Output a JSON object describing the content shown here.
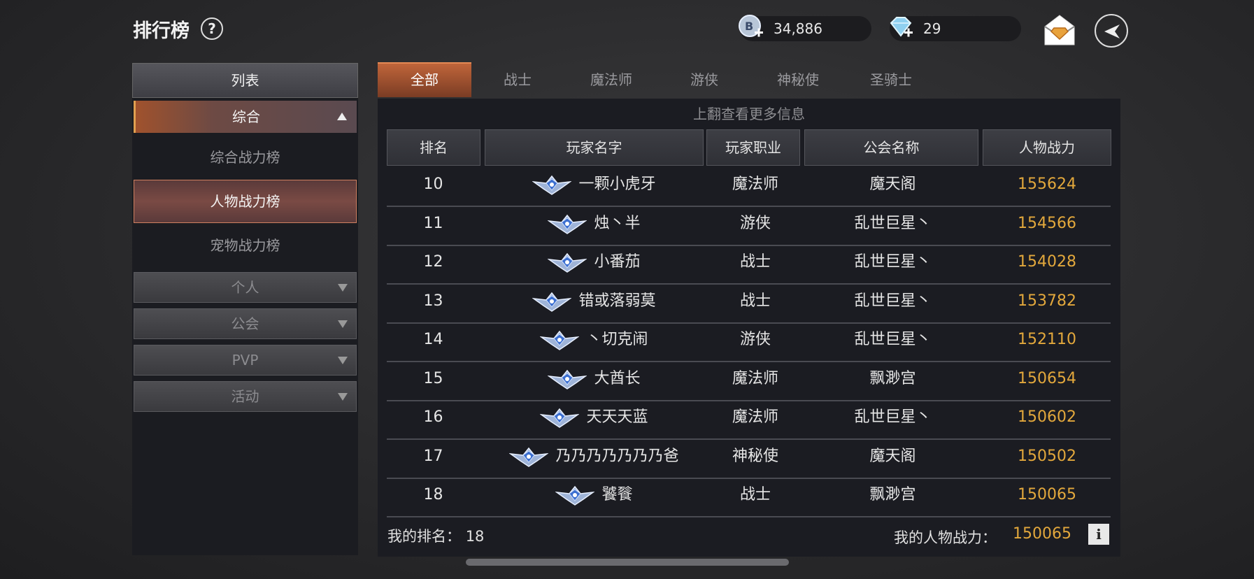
{
  "header": {
    "title": "排行榜",
    "help_label": "?",
    "gold_amount": "34,886",
    "diamond_amount": "29"
  },
  "sidebar": {
    "header": "列表",
    "active_category": "综合",
    "sub_items": [
      {
        "label": "综合战力榜",
        "active": false
      },
      {
        "label": "人物战力榜",
        "active": true
      },
      {
        "label": "宠物战力榜",
        "active": false
      }
    ],
    "categories": [
      "个人",
      "公会",
      "PVP",
      "活动"
    ]
  },
  "tabs": [
    {
      "label": "全部",
      "active": true
    },
    {
      "label": "战士",
      "active": false
    },
    {
      "label": "魔法师",
      "active": false
    },
    {
      "label": "游侠",
      "active": false
    },
    {
      "label": "神秘使",
      "active": false
    },
    {
      "label": "圣骑士",
      "active": false
    }
  ],
  "table": {
    "hint": "上翻查看更多信息",
    "headers": [
      "排名",
      "玩家名字",
      "玩家职业",
      "公会名称",
      "人物战力"
    ],
    "rows": [
      {
        "rank": "10",
        "name": "一颗小虎牙",
        "job": "魔法师",
        "guild": "魔天阁",
        "power": "155624"
      },
      {
        "rank": "11",
        "name": "烛丶半",
        "job": "游侠",
        "guild": "乱世巨星丶",
        "power": "154566"
      },
      {
        "rank": "12",
        "name": "小番茄",
        "job": "战士",
        "guild": "乱世巨星丶",
        "power": "154028"
      },
      {
        "rank": "13",
        "name": "错或落弱莫",
        "job": "战士",
        "guild": "乱世巨星丶",
        "power": "153782"
      },
      {
        "rank": "14",
        "name": "丶切克闹",
        "job": "游侠",
        "guild": "乱世巨星丶",
        "power": "152110"
      },
      {
        "rank": "15",
        "name": "大酋长",
        "job": "魔法师",
        "guild": "飘渺宫",
        "power": "150654"
      },
      {
        "rank": "16",
        "name": "天天天蓝",
        "job": "魔法师",
        "guild": "乱世巨星丶",
        "power": "150602"
      },
      {
        "rank": "17",
        "name": "乃乃乃乃乃乃乃爸",
        "job": "神秘使",
        "guild": "魔天阁",
        "power": "150502"
      },
      {
        "rank": "18",
        "name": "饕餮",
        "job": "战士",
        "guild": "飘渺宫",
        "power": "150065"
      }
    ]
  },
  "footer": {
    "my_rank_label": "我的排名：",
    "my_rank": "18",
    "my_power_label": "我的人物战力：",
    "my_power": "150065",
    "info_label": "i"
  },
  "colors": {
    "accent": "#c0653a",
    "power": "#e3a83c"
  }
}
